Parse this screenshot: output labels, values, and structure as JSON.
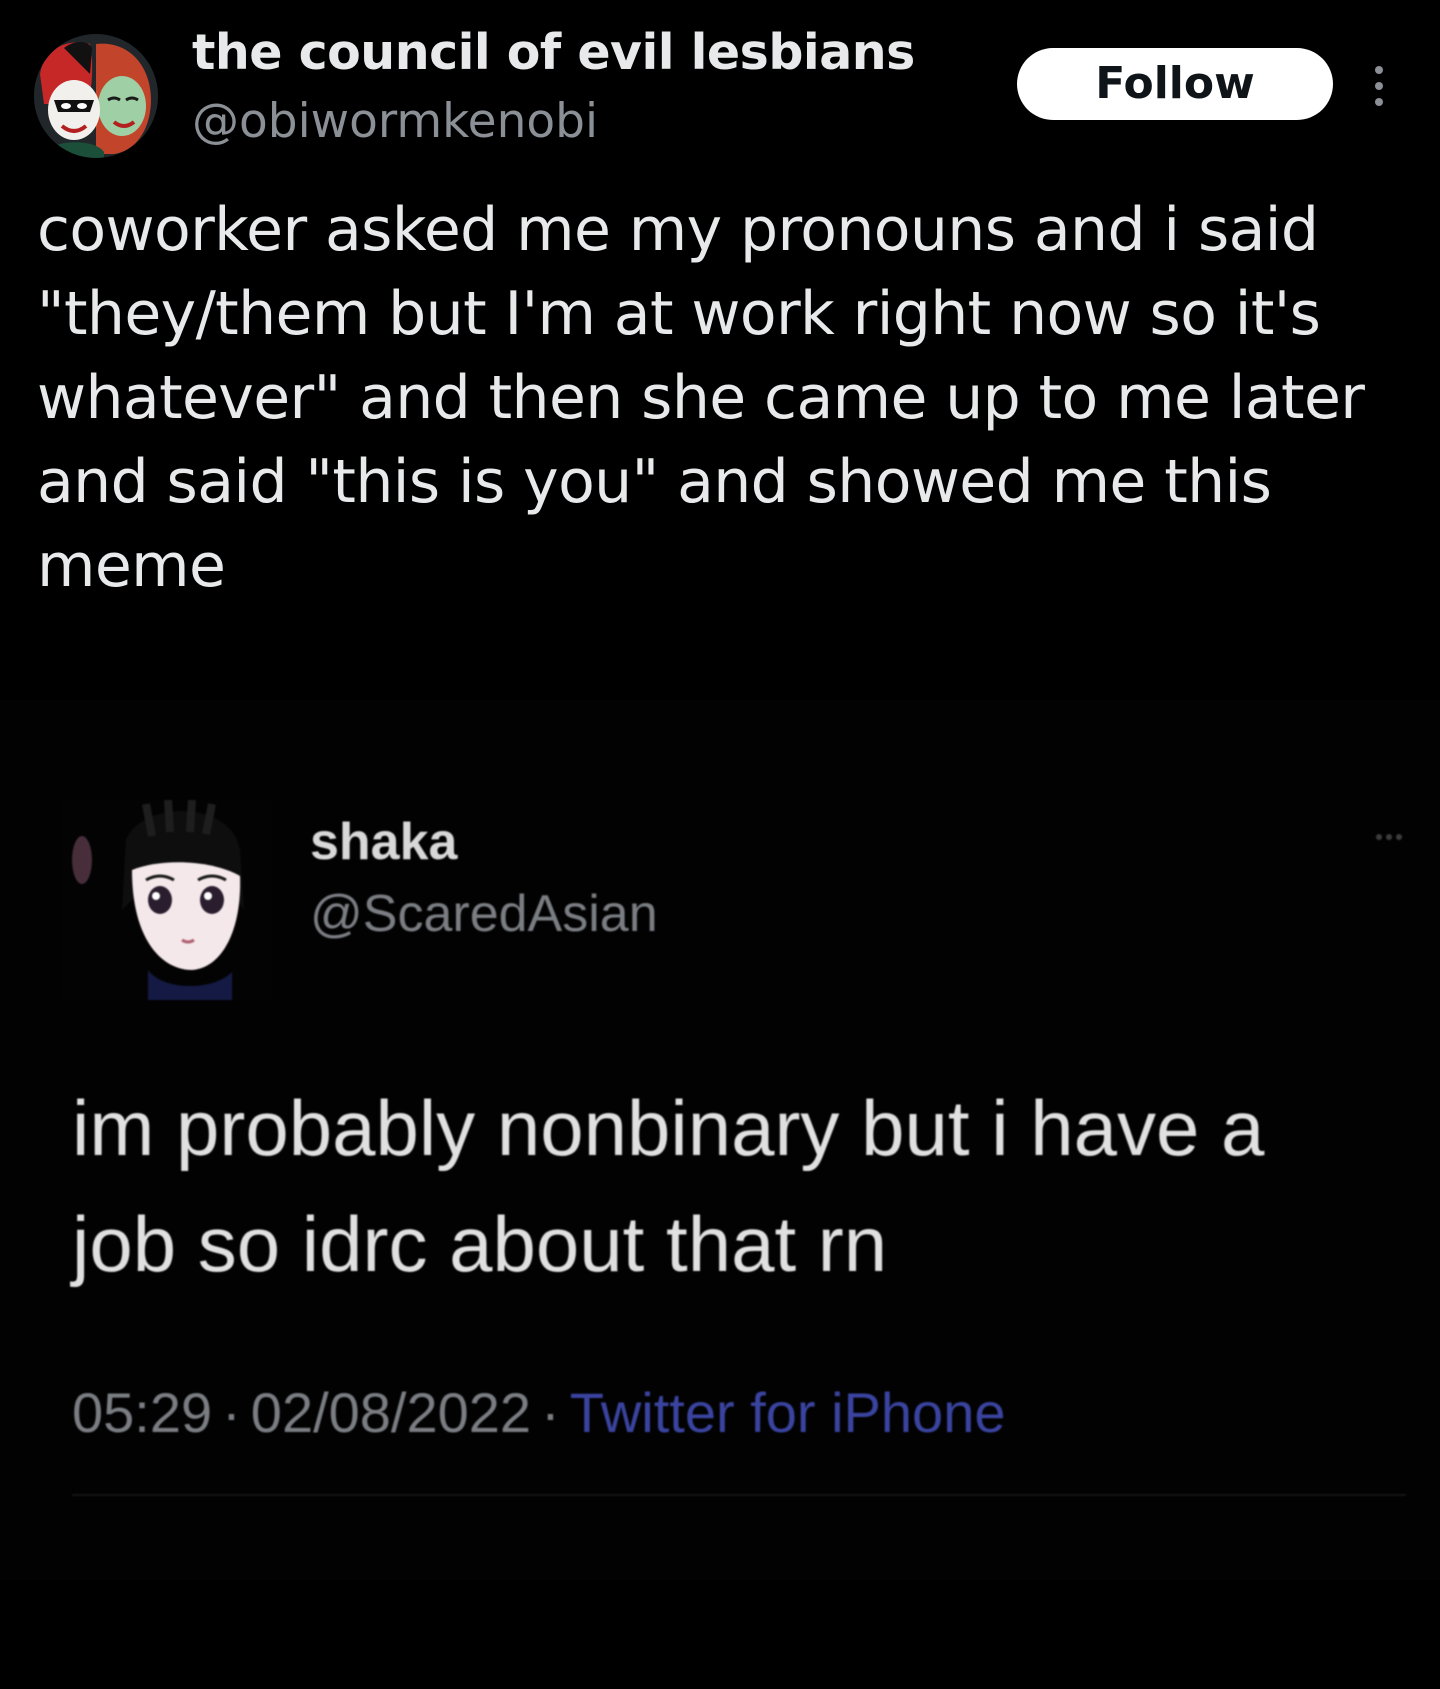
{
  "post": {
    "author": {
      "display_name": "the council of evil lesbians",
      "handle": "@obiwormkenobi",
      "avatar_icon": "harley-quinn-and-poison-ivy-avatar"
    },
    "follow_label": "Follow",
    "more_icon": "vertical-ellipsis-icon",
    "text": "coworker asked me my pronouns and i said\n\"they/them but I'm at work right now so it's\nwhatever\" and then she came up to me later\nand said \"this is you\" and showed me this\nmeme"
  },
  "embedded_image": {
    "author": {
      "display_name": "shaka",
      "handle": "@ScaredAsian",
      "avatar_icon": "anime-girl-avatar"
    },
    "text": "im probably nonbinary but i have a\njob so idrc about that rn",
    "time": "05:29",
    "date": "02/08/2022",
    "separator": "·",
    "source": "Twitter for iPhone"
  },
  "colors": {
    "background": "#000000",
    "primary_text": "#e7e9ea",
    "secondary_text": "#8b9096",
    "follow_bg": "#ffffff",
    "source_link": "#3a44a0"
  }
}
